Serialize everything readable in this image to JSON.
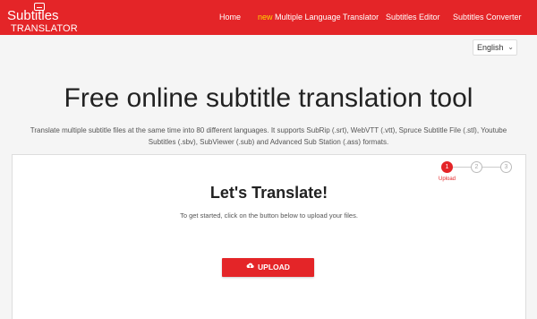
{
  "brand": {
    "line1": "Subtitles",
    "line2": "TRANSLATOR",
    "color": "#e42528"
  },
  "nav": {
    "home": "Home",
    "new_badge": "new",
    "multi_translator": "Multiple Language Translator",
    "editor": "Subtitles Editor",
    "converter": "Subtitles Converter"
  },
  "language_select": {
    "value": "English",
    "icon": "chevron-down-icon"
  },
  "hero": {
    "title": "Free online subtitle translation tool",
    "description": "Translate multiple subtitle files at the same time into 80 different languages. It supports SubRip (.srt), WebVTT (.vtt), Spruce Subtitle File (.stl), Youtube Subtitles (.sbv), SubViewer (.sub) and Advanced Sub Station (.ass) formats."
  },
  "stepper": {
    "steps": [
      "1",
      "2",
      "3"
    ],
    "active_label": "Upload",
    "active_step": 1
  },
  "card": {
    "title": "Let's Translate!",
    "subtitle": "To get started, click on the button below to upload your files.",
    "upload_label": "UPLOAD",
    "upload_icon": "cloud-upload-icon"
  }
}
